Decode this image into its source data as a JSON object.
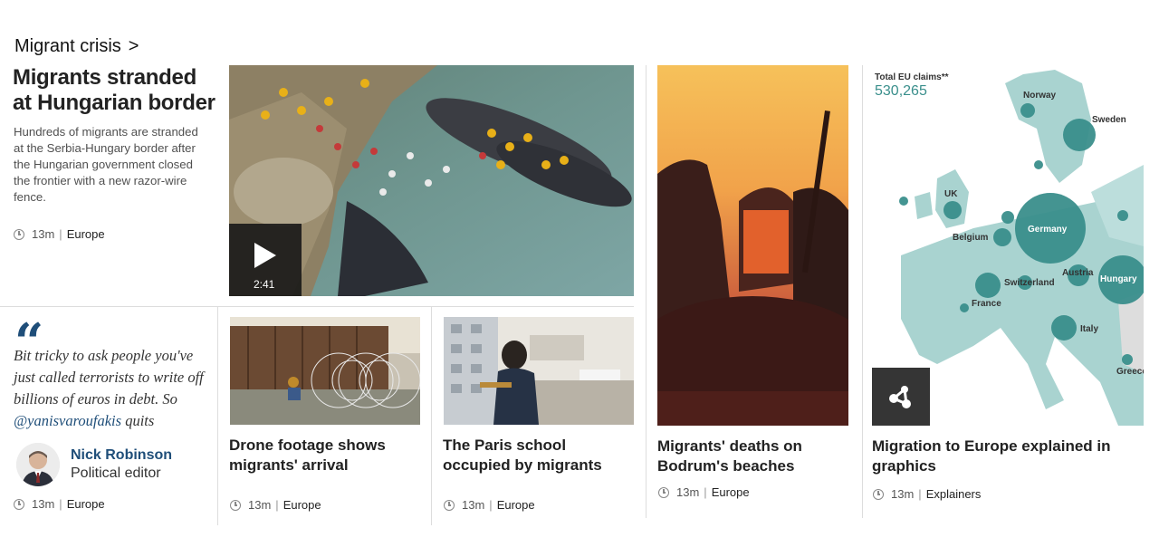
{
  "section": {
    "label": "Migrant crisis",
    "chevron": ">"
  },
  "lead": {
    "title": "Migrants stranded at Hungarian border",
    "summary": "Hundreds of migrants are stranded at the Serbia-Hungary border after the Hungarian government closed the frontier with a new razor-wire fence.",
    "time": "13m",
    "tag": "Europe",
    "video_duration": "2:41"
  },
  "quote": {
    "mark": "“",
    "text_before": "Bit tricky to ask people you've just called terrorists to write off billions of euros in debt. So ",
    "handle": "@yanisvaroufakis",
    "text_after": " quits",
    "author_name": "Nick Robinson",
    "author_role": "Political editor",
    "time": "13m",
    "tag": "Europe"
  },
  "cards": [
    {
      "title": "Drone footage shows migrants' arrival",
      "time": "13m",
      "tag": "Europe"
    },
    {
      "title": "The Paris school occupied by migrants",
      "time": "13m",
      "tag": "Europe"
    },
    {
      "title": "Migrants' deaths on Bodrum's beaches",
      "time": "13m",
      "tag": "Europe"
    },
    {
      "title": "Migration to Europe explained in graphics",
      "time": "13m",
      "tag": "Explainers"
    }
  ],
  "map": {
    "claims_label": "Total EU claims**",
    "claims_value": "530,265",
    "countries": [
      "Norway",
      "Sweden",
      "UK",
      "Germany",
      "Belgium",
      "Switzerland",
      "Austria",
      "Hungary",
      "France",
      "Italy",
      "Greece"
    ]
  },
  "colors": {
    "link_blue": "#1f4e79",
    "map_teal": "#3a8f8c",
    "map_land": "#a9d3d0"
  },
  "icons": [
    "play-icon",
    "clock-icon",
    "share-graphic-icon",
    "quote-icon"
  ]
}
